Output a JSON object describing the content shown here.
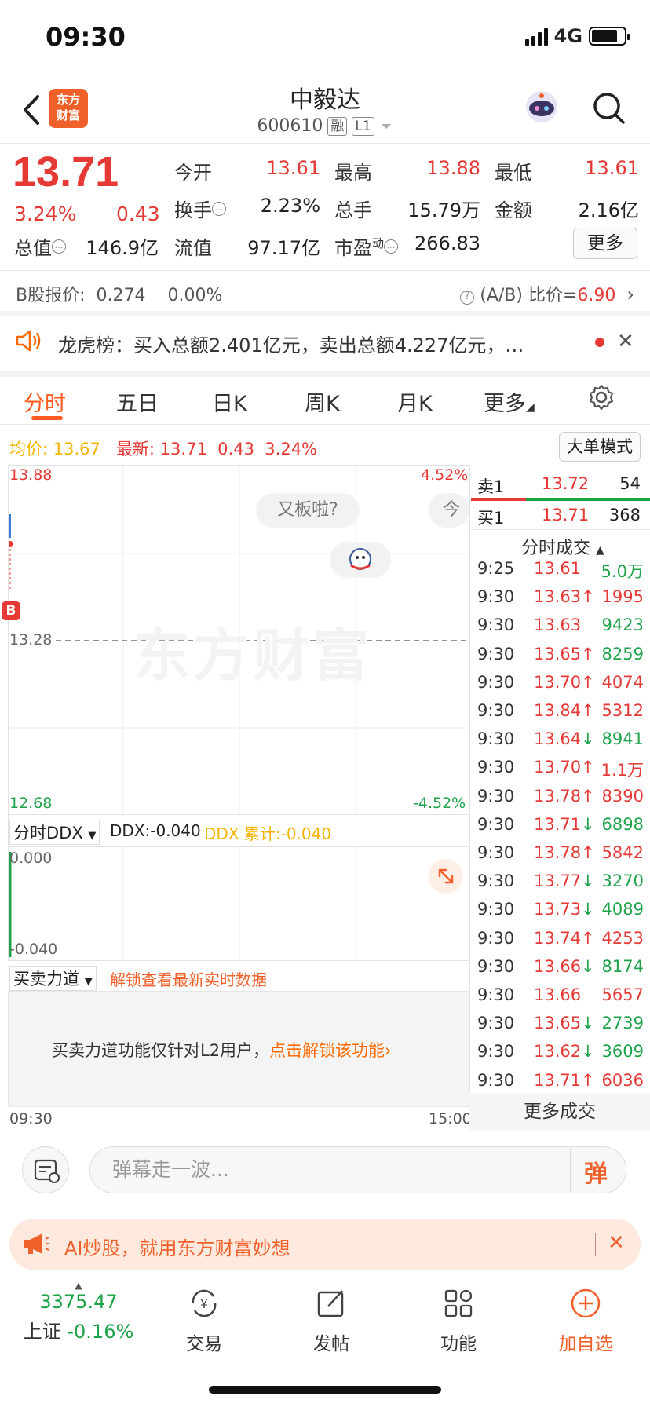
{
  "status_bar": {
    "time": "09:30",
    "network": "4G"
  },
  "header": {
    "brand_logo": "东方\n财富",
    "stock_name": "中毅达",
    "stock_code": "600610",
    "tag_rong": "融",
    "tag_level": "L1"
  },
  "quote": {
    "price": "13.71",
    "change_pct": "3.24%",
    "change": "0.43",
    "fields": [
      {
        "label": "今开",
        "value": "13.61"
      },
      {
        "label": "最高",
        "value": "13.88"
      },
      {
        "label": "最低",
        "value": "13.61"
      },
      {
        "label": "换手",
        "value": "2.23%"
      },
      {
        "label": "总手",
        "value": "15.79万"
      },
      {
        "label": "金额",
        "value": "2.16亿"
      },
      {
        "label": "总值",
        "value": "146.9亿"
      },
      {
        "label": "流值",
        "value": "97.17亿"
      },
      {
        "label": "市盈",
        "value": "266.83"
      }
    ],
    "pe_superscript": "动",
    "more_label": "更多"
  },
  "bshare": {
    "label": "B股报价:",
    "price": "0.274",
    "pct": "0.00%",
    "ratio_label": "(A/B) 比价=",
    "ratio_value": "6.90"
  },
  "notice": {
    "text": "龙虎榜：买入总额2.401亿元，卖出总额4.227亿元，…"
  },
  "tabs": [
    "分时",
    "五日",
    "日K",
    "周K",
    "月K",
    "更多"
  ],
  "chart_header": {
    "avg_label": "均价:",
    "avg_value": "13.67",
    "latest_label": "最新:",
    "latest_value": "13.71",
    "change": "0.43",
    "pct": "3.24%",
    "bigorder_label": "大单模式"
  },
  "price_chart": {
    "high": "13.88",
    "mid": "13.28",
    "low": "12.68",
    "high_pct": "4.52%",
    "low_pct": "-4.52%",
    "watermark": "东方财富",
    "bubble_1": "又板啦?",
    "bubble_2": "今天",
    "b_marker": "B"
  },
  "ddx": {
    "selector": "分时DDX",
    "ddx_label": "DDX:-0.040",
    "ddx_cum_label": "DDX 累计:-0.040",
    "top": "0.000",
    "bottom": "-0.040"
  },
  "mmld": {
    "selector": "买卖力道",
    "unlock_hint": "解锁查看最新实时数据",
    "msg": "买卖力道功能仅针对L2用户，",
    "link": "点击解锁该功能›"
  },
  "time_axis": {
    "start": "09:30",
    "end": "15:00"
  },
  "orderbook": {
    "sell1": {
      "label": "卖1",
      "price": "13.72",
      "vol": "54"
    },
    "buy1": {
      "label": "买1",
      "price": "13.71",
      "vol": "368"
    }
  },
  "ticks_title": "分时成交",
  "ticks": [
    {
      "t": "9:25",
      "p": "13.61",
      "arrow": "",
      "v": "5.0万",
      "vc": "green"
    },
    {
      "t": "9:30",
      "p": "13.63",
      "arrow": "↑",
      "v": "1995",
      "vc": "red"
    },
    {
      "t": "9:30",
      "p": "13.63",
      "arrow": "",
      "v": "9423",
      "vc": "green"
    },
    {
      "t": "9:30",
      "p": "13.65",
      "arrow": "↑",
      "v": "8259",
      "vc": "green"
    },
    {
      "t": "9:30",
      "p": "13.70",
      "arrow": "↑",
      "v": "4074",
      "vc": "red"
    },
    {
      "t": "9:30",
      "p": "13.84",
      "arrow": "↑",
      "v": "5312",
      "vc": "red"
    },
    {
      "t": "9:30",
      "p": "13.64",
      "arrow": "↓",
      "v": "8941",
      "vc": "green"
    },
    {
      "t": "9:30",
      "p": "13.70",
      "arrow": "↑",
      "v": "1.1万",
      "vc": "red"
    },
    {
      "t": "9:30",
      "p": "13.78",
      "arrow": "↑",
      "v": "8390",
      "vc": "red"
    },
    {
      "t": "9:30",
      "p": "13.71",
      "arrow": "↓",
      "v": "6898",
      "vc": "green"
    },
    {
      "t": "9:30",
      "p": "13.78",
      "arrow": "↑",
      "v": "5842",
      "vc": "red"
    },
    {
      "t": "9:30",
      "p": "13.77",
      "arrow": "↓",
      "v": "3270",
      "vc": "green"
    },
    {
      "t": "9:30",
      "p": "13.73",
      "arrow": "↓",
      "v": "4089",
      "vc": "green"
    },
    {
      "t": "9:30",
      "p": "13.74",
      "arrow": "↑",
      "v": "4253",
      "vc": "red"
    },
    {
      "t": "9:30",
      "p": "13.66",
      "arrow": "↓",
      "v": "8174",
      "vc": "green"
    },
    {
      "t": "9:30",
      "p": "13.66",
      "arrow": "",
      "v": "5657",
      "vc": "red"
    },
    {
      "t": "9:30",
      "p": "13.65",
      "arrow": "↓",
      "v": "2739",
      "vc": "green"
    },
    {
      "t": "9:30",
      "p": "13.62",
      "arrow": "↓",
      "v": "3609",
      "vc": "green"
    },
    {
      "t": "9:30",
      "p": "13.71",
      "arrow": "↑",
      "v": "6036",
      "vc": "red"
    }
  ],
  "more_ticks": "更多成交",
  "danmu": {
    "placeholder": "弹幕走一波...",
    "send": "弹"
  },
  "ai_banner": {
    "text": "AI炒股，就用东方财富妙想"
  },
  "bottom_nav": {
    "index_value": "3375.47",
    "index_name": "上证",
    "index_pct": "-0.16%",
    "trade": "交易",
    "post": "发帖",
    "func": "功能",
    "add": "加自选"
  },
  "colors": {
    "up": "#e53935",
    "down": "#1fa34a",
    "accent": "#ff5a1f",
    "avg": "#f4b400"
  }
}
